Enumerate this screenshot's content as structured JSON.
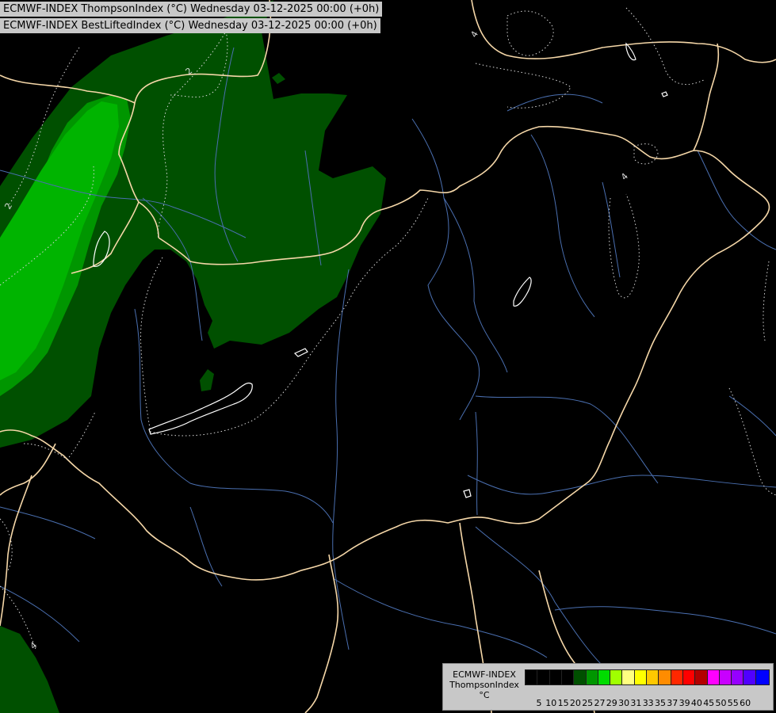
{
  "titles": {
    "line1": "ECMWF-INDEX ThompsonIndex (°C) Wednesday 03-12-2025 00:00 (+0h)",
    "line2": "ECMWF-INDEX BestLiftedIndex (°C) Wednesday 03-12-2025 00:00 (+0h)"
  },
  "legend": {
    "model": "ECMWF-INDEX",
    "parameter": "ThompsonIndex",
    "unit": "°C",
    "colors": [
      "#000000",
      "#000000",
      "#000000",
      "#000000",
      "#005000",
      "#009600",
      "#00dc00",
      "#a0ff00",
      "#ffff80",
      "#ffff00",
      "#ffc800",
      "#ff8c00",
      "#ff2800",
      "#ff0000",
      "#b40000",
      "#ff00ff",
      "#c800ff",
      "#9600ff",
      "#5000ff",
      "#0000ff"
    ],
    "ticks": [
      "5",
      "10",
      "15",
      "20",
      "25",
      "27",
      "29",
      "30",
      "31",
      "33",
      "35",
      "37",
      "39",
      "40",
      "45",
      "50",
      "55",
      "60"
    ]
  },
  "map": {
    "contour_labels": [
      "2",
      "2",
      "4",
      "4",
      "4"
    ],
    "colors": {
      "background": "#000000",
      "dark_green": "#005000",
      "mid_green": "#009600",
      "light_green": "#00b400",
      "border": "#f5d7a8",
      "river": "#4a6fb0",
      "contour": "#d8d8d8"
    }
  }
}
